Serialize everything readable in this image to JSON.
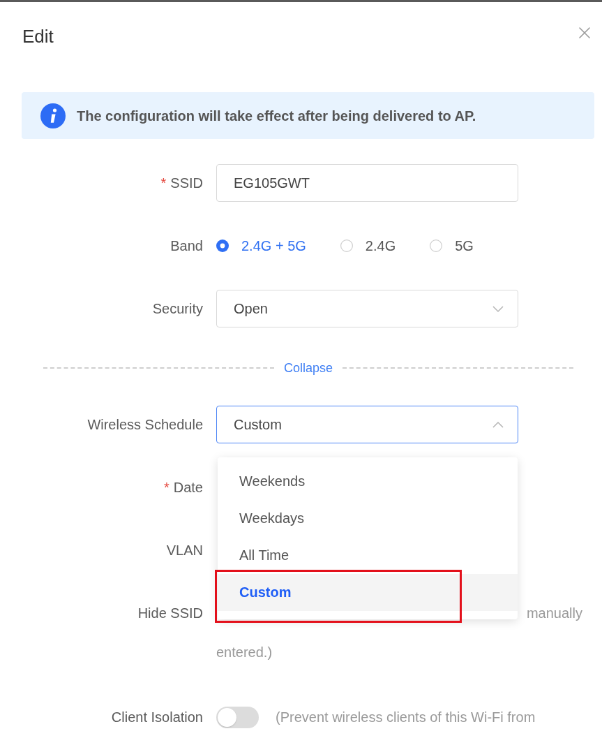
{
  "dialog": {
    "title": "Edit"
  },
  "notice": {
    "text": "The configuration will take effect after being delivered to AP."
  },
  "fields": [
    {
      "kind": "text",
      "label": "SSID",
      "required_mark": "*",
      "value": "EG105GWT"
    },
    {
      "kind": "radio",
      "label": "Band",
      "options": [
        {
          "label": "2.4G + 5G",
          "selected": true
        },
        {
          "label": "2.4G",
          "selected": false
        },
        {
          "label": "5G",
          "selected": false
        }
      ]
    },
    {
      "kind": "select",
      "label": "Security",
      "value": "Open",
      "expanded": false
    },
    {
      "kind": "divider",
      "link": "Collapse"
    },
    {
      "kind": "select",
      "label": "Wireless Schedule",
      "value": "Custom",
      "expanded": true,
      "options": [
        {
          "label": "Weekends",
          "selected": false,
          "highlighted": false
        },
        {
          "label": "Weekdays",
          "selected": false,
          "highlighted": false
        },
        {
          "label": "All Time",
          "selected": false,
          "highlighted": false
        },
        {
          "label": "Custom",
          "selected": true,
          "highlighted": true
        }
      ]
    },
    {
      "kind": "covered",
      "label": "Date",
      "required_mark": "*"
    },
    {
      "kind": "covered",
      "label": "VLAN"
    },
    {
      "kind": "covered",
      "label": "Hide SSID",
      "hint_parts": [
        "manually",
        "entered.)"
      ]
    },
    {
      "kind": "toggle",
      "label": "Client Isolation",
      "on": false,
      "hint": "(Prevent wireless clients of this Wi-Fi from"
    }
  ]
}
